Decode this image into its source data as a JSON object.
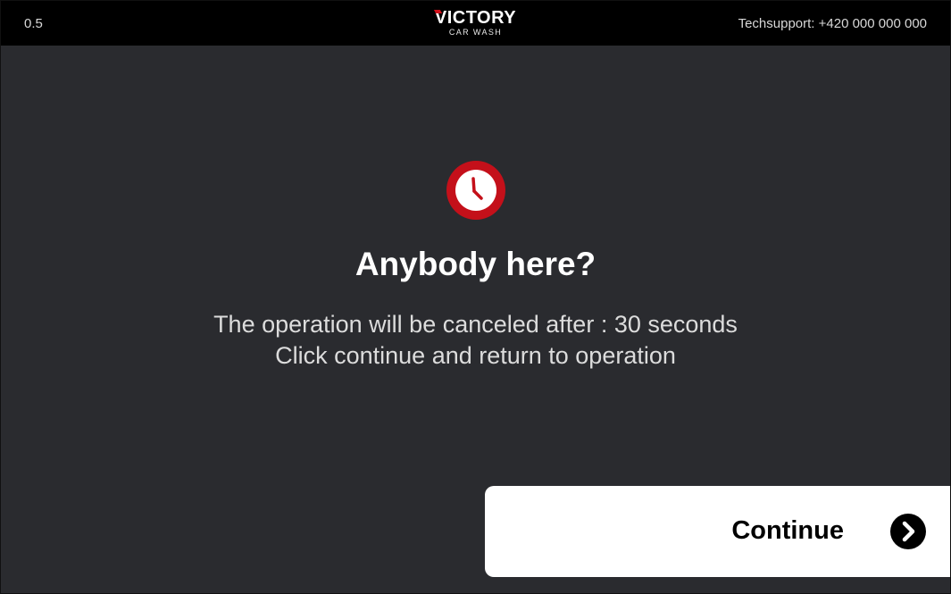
{
  "header": {
    "version": "0.5",
    "logo_main_first": "V",
    "logo_main_rest": "ICTORY",
    "logo_sub": "CAR WASH",
    "support": "Techsupport: +420 000 000 000"
  },
  "dialog": {
    "icon": "clock-icon",
    "title": "Anybody here?",
    "line1": "The operation will be canceled after : 30 seconds",
    "line2": "Click continue and return to operation"
  },
  "actions": {
    "continue_label": "Continue",
    "continue_icon": "chevron-right-icon"
  },
  "colors": {
    "background": "#2a2b2f",
    "topbar": "#000000",
    "accent": "#c4101a",
    "button": "#ffffff"
  }
}
